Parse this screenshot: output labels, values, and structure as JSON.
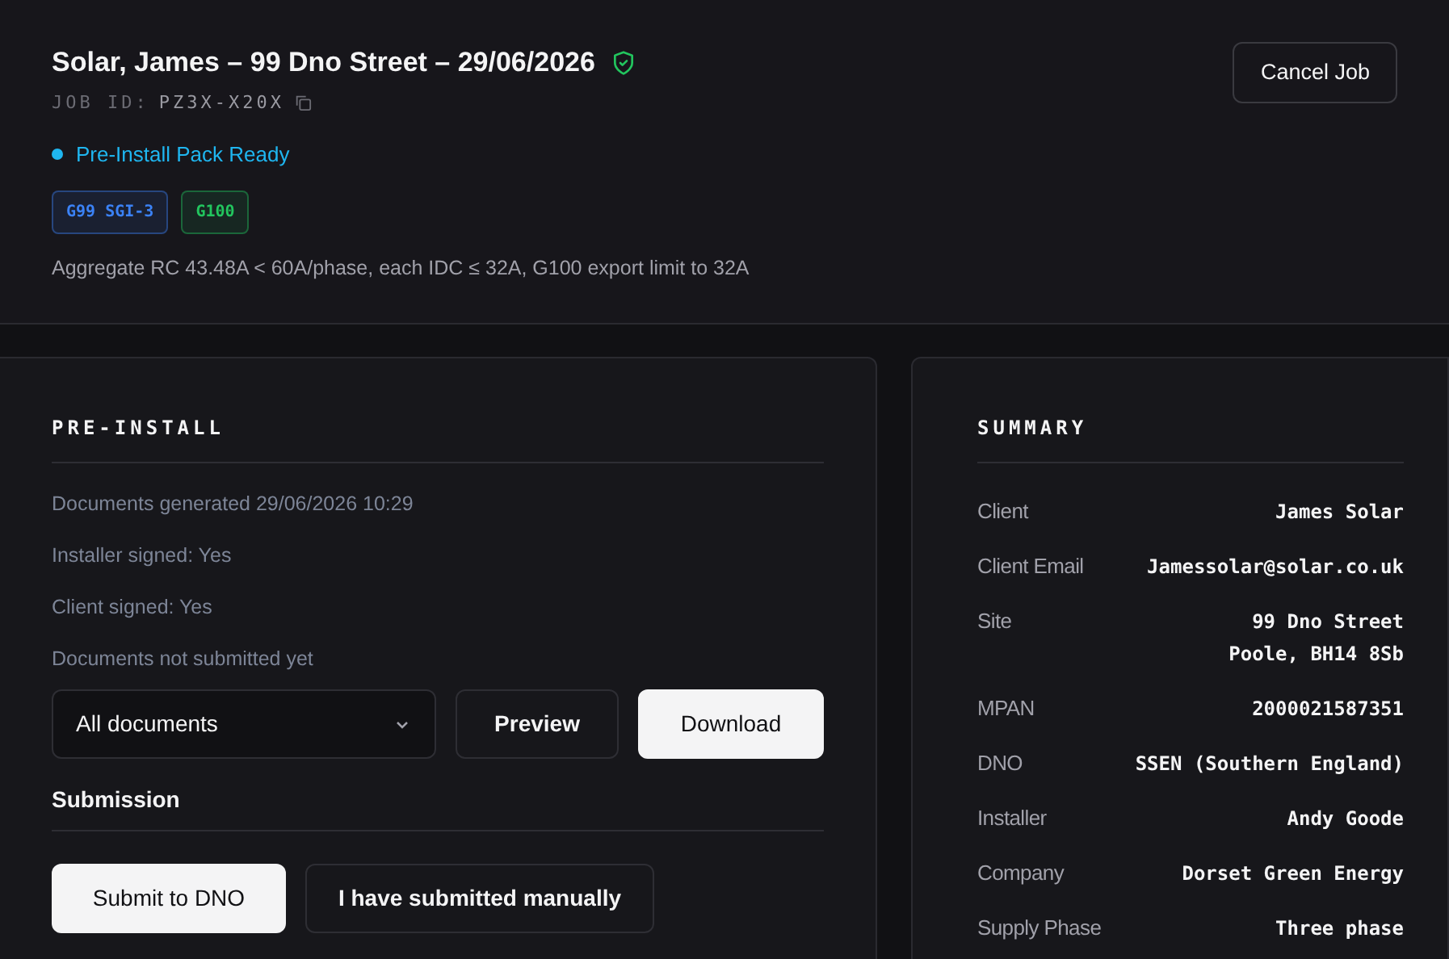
{
  "header": {
    "title": "Solar, James – 99 Dno Street – 29/06/2026",
    "verified": true,
    "job_id_label": "JOB ID:",
    "job_id": "PZ3X-X20X",
    "status": {
      "label": "Pre-Install Pack Ready",
      "color": "#1fb6f0"
    },
    "tags": [
      {
        "label": "G99 SGI-3",
        "color": "#3b82f6"
      },
      {
        "label": "G100",
        "color": "#22c55e"
      }
    ],
    "note": "Aggregate RC 43.48A < 60A/phase, each IDC ≤ 32A, G100 export limit to 32A",
    "cancel_button": "Cancel Job"
  },
  "pre_install": {
    "title": "PRE-INSTALL",
    "lines": [
      "Documents generated 29/06/2026 10:29",
      "Installer signed: Yes",
      "Client signed: Yes",
      "Documents not submitted yet"
    ],
    "document_select": {
      "value": "All documents"
    },
    "preview_button": "Preview",
    "download_button": "Download",
    "submission_title": "Submission",
    "submit_button": "Submit to DNO",
    "manual_button": "I have submitted manually"
  },
  "summary": {
    "title": "SUMMARY",
    "rows": [
      {
        "label": "Client",
        "value": [
          "James Solar"
        ]
      },
      {
        "label": "Client Email",
        "value": [
          "Jamessolar@solar.co.uk"
        ]
      },
      {
        "label": "Site",
        "value": [
          "99 Dno Street",
          "Poole, BH14 8Sb"
        ]
      },
      {
        "label": "MPAN",
        "value": [
          "2000021587351"
        ]
      },
      {
        "label": "DNO",
        "value": [
          "SSEN (Southern England)"
        ]
      },
      {
        "label": "Installer",
        "value": [
          "Andy Goode"
        ]
      },
      {
        "label": "Company",
        "value": [
          "Dorset Green Energy"
        ]
      },
      {
        "label": "Supply Phase",
        "value": [
          "Three phase"
        ]
      }
    ]
  }
}
